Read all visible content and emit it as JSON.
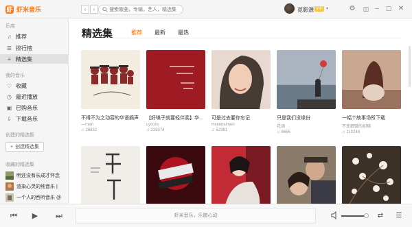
{
  "app": {
    "name": "虾米音乐"
  },
  "search": {
    "placeholder": "搜索歌曲，专辑，艺人，精选集"
  },
  "user": {
    "name": "苋影源",
    "badge": "VIP"
  },
  "sidebar": {
    "sections": [
      {
        "title": "乐库",
        "items": [
          {
            "label": "推荐",
            "icon": "music-note-icon"
          },
          {
            "label": "排行榜",
            "icon": "chart-icon"
          },
          {
            "label": "精选集",
            "icon": "playlist-icon",
            "active": true
          }
        ]
      },
      {
        "title": "我的音乐",
        "items": [
          {
            "label": "收藏",
            "icon": "heart-icon"
          },
          {
            "label": "最近播放",
            "icon": "clock-icon"
          },
          {
            "label": "已购音乐",
            "icon": "purchased-icon"
          },
          {
            "label": "下载音乐",
            "icon": "download-icon"
          }
        ]
      }
    ],
    "created_title": "创建的精选集",
    "create_button": "创建精选集",
    "favorites_title": "收藏的精选集",
    "favorites": [
      {
        "label": "明还没有长成才怀念"
      },
      {
        "label": "渲染心灵的纯音乐 |"
      },
      {
        "label": "一个人的西听音乐 @"
      }
    ]
  },
  "main": {
    "title": "精选集",
    "tabs": [
      {
        "label": "推荐",
        "active": true
      },
      {
        "label": "最新"
      },
      {
        "label": "最热"
      }
    ],
    "cards": [
      {
        "title": "不得不为之动容的华语摘声",
        "author": "—Fern",
        "plays": "26832"
      },
      {
        "title": "【好嗓子就要轻伴奏】华...",
        "author": "Lycoris",
        "plays": "229374"
      },
      {
        "title": "可是过去要你忘记",
        "author": "Heitehiumen",
        "plays": "52381"
      },
      {
        "title": "只是我们没缘份",
        "author": "花颂",
        "plays": "8655"
      },
      {
        "title": "一幅个故事场所下载",
        "author": "不变细微的初暗",
        "plays": "110248"
      },
      {
        "title": "",
        "author": "",
        "plays": ""
      },
      {
        "title": "",
        "author": "",
        "plays": ""
      },
      {
        "title": "",
        "author": "",
        "plays": ""
      },
      {
        "title": "",
        "author": "",
        "plays": ""
      },
      {
        "title": "",
        "author": "",
        "plays": ""
      }
    ]
  },
  "player": {
    "now_playing": "虾米音乐，乐随心动",
    "volume_percent": 85
  }
}
